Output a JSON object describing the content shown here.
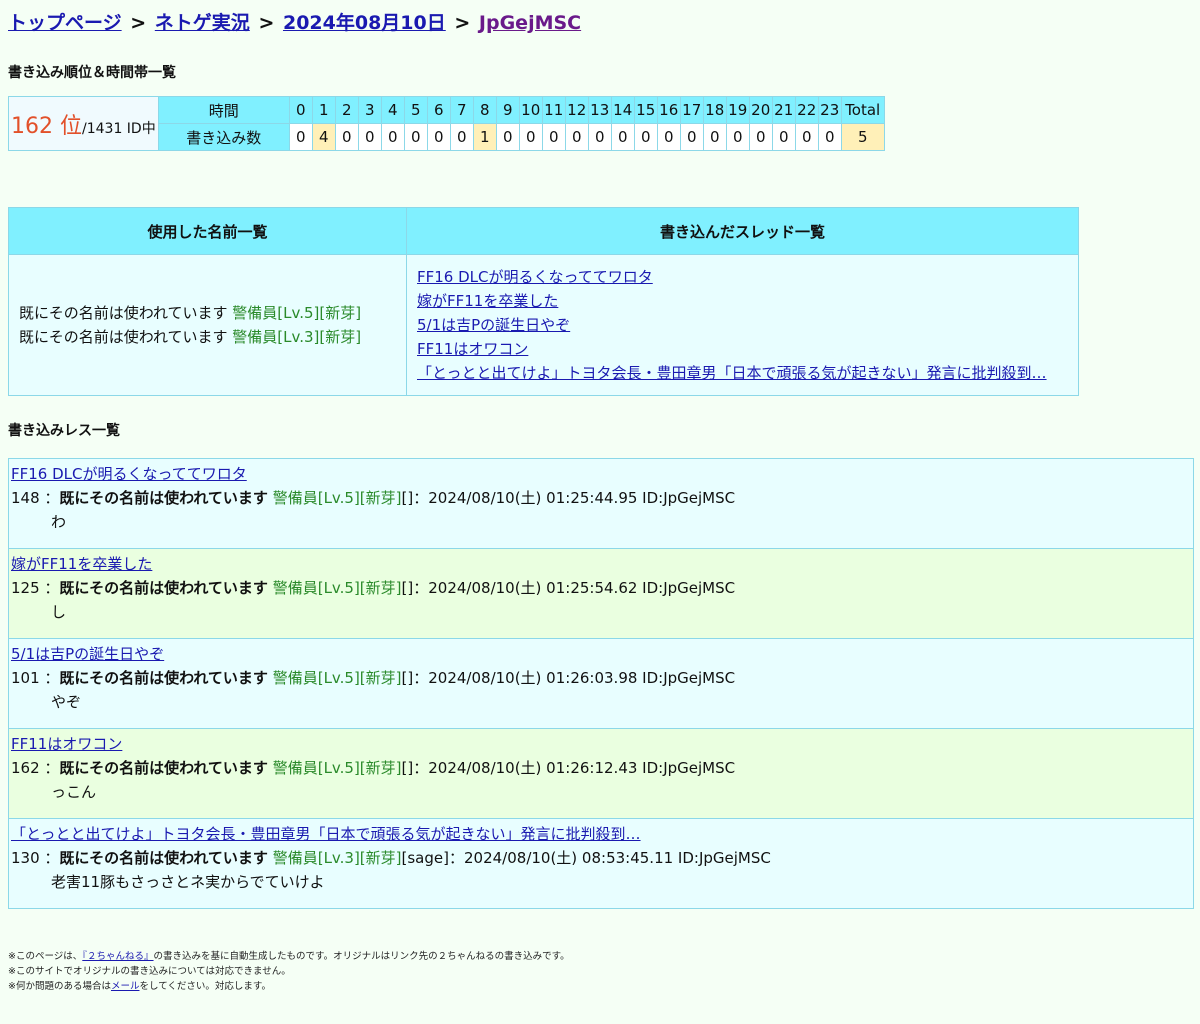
{
  "breadcrumb": {
    "home": "トップページ",
    "board": "ネトゲ実況",
    "date": "2024年08月10日",
    "id": "JpGejMSC",
    "sep": ">"
  },
  "section1_title": "書き込み順位＆時間帯一覧",
  "rank": {
    "position": "162 位",
    "total": "/1431 ID中"
  },
  "hours_table": {
    "time_label": "時間",
    "count_label": "書き込み数",
    "hours": [
      "0",
      "1",
      "2",
      "3",
      "4",
      "5",
      "6",
      "7",
      "8",
      "9",
      "10",
      "11",
      "12",
      "13",
      "14",
      "15",
      "16",
      "17",
      "18",
      "19",
      "20",
      "21",
      "22",
      "23"
    ],
    "counts": [
      "0",
      "4",
      "0",
      "0",
      "0",
      "0",
      "0",
      "0",
      "1",
      "0",
      "0",
      "0",
      "0",
      "0",
      "0",
      "0",
      "0",
      "0",
      "0",
      "0",
      "0",
      "0",
      "0",
      "0"
    ],
    "total_label": "Total",
    "total": "5"
  },
  "names_header": "使用した名前一覧",
  "threads_header": "書き込んだスレッド一覧",
  "names": [
    {
      "name": "既にその名前は使われています",
      "tag": "警備員[Lv.5][新芽]"
    },
    {
      "name": "既にその名前は使われています",
      "tag": "警備員[Lv.3][新芽]"
    }
  ],
  "threads": [
    "FF16 DLCが明るくなっててワロタ",
    "嫁がFF11を卒業した",
    "5/1は吉Pの誕生日やぞ",
    "FF11はオワコン",
    "「とっとと出てけよ」トヨタ会長・豊田章男「日本で頑張る気が起きない」発言に批判殺到…"
  ],
  "section2_title": "書き込みレス一覧",
  "responses": [
    {
      "thread": "FF16 DLCが明るくなっててワロタ",
      "num": "148",
      "name": "既にその名前は使われています",
      "tag": "警備員[Lv.5][新芽]",
      "mail": "[]",
      "datetime": "2024/08/10(土) 01:25:44.95 ID:JpGejMSC",
      "body": "わ"
    },
    {
      "thread": "嫁がFF11を卒業した",
      "num": "125",
      "name": "既にその名前は使われています",
      "tag": "警備員[Lv.5][新芽]",
      "mail": "[]",
      "datetime": "2024/08/10(土) 01:25:54.62 ID:JpGejMSC",
      "body": "し"
    },
    {
      "thread": "5/1は吉Pの誕生日やぞ",
      "num": "101",
      "name": "既にその名前は使われています",
      "tag": "警備員[Lv.5][新芽]",
      "mail": "[]",
      "datetime": "2024/08/10(土) 01:26:03.98 ID:JpGejMSC",
      "body": "やぞ"
    },
    {
      "thread": "FF11はオワコン",
      "num": "162",
      "name": "既にその名前は使われています",
      "tag": "警備員[Lv.5][新芽]",
      "mail": "[]",
      "datetime": "2024/08/10(土) 01:26:12.43 ID:JpGejMSC",
      "body": "っこん"
    },
    {
      "thread": "「とっとと出てけよ」トヨタ会長・豊田章男「日本で頑張る気が起きない」発言に批判殺到…",
      "num": "130",
      "name": "既にその名前は使われています",
      "tag": "警備員[Lv.3][新芽]",
      "mail": "[sage]",
      "datetime": "2024/08/10(土) 08:53:45.11 ID:JpGejMSC",
      "body": "老害11豚もさっさとネ実からでていけよ"
    }
  ],
  "footer": {
    "line1_prefix": "※このページは、",
    "line1_link": "『２ちゃんねる』",
    "line1_suffix": "の書き込みを基に自動生成したものです。オリジナルはリンク先の２ちゃんねるの書き込みです。",
    "line2": "※このサイトでオリジナルの書き込みについては対応できません。",
    "line3_prefix": "※何か問題のある場合は",
    "line3_link": "メール",
    "line3_suffix": "をしてください。対応します。"
  }
}
